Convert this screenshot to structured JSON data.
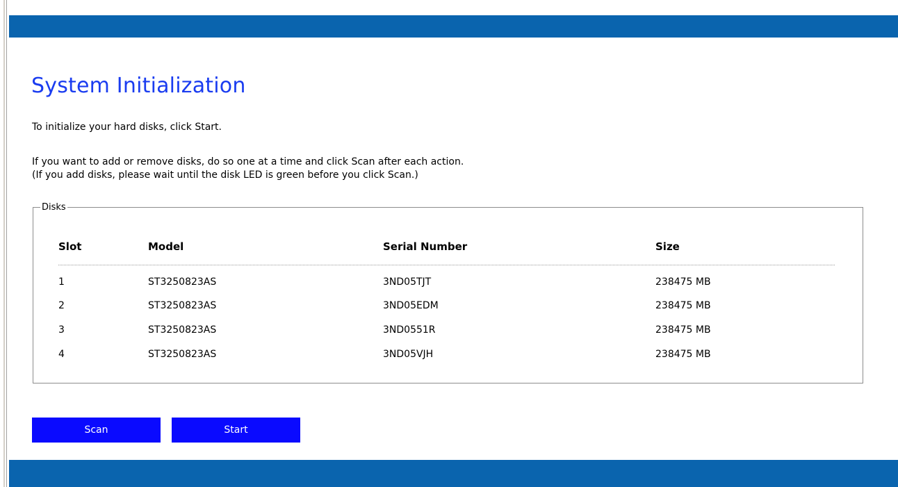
{
  "page": {
    "title": "System Initialization",
    "instruction_start": "To initialize your hard disks, click Start.",
    "instruction_scan_1": "If you want to add or remove disks, do so one at a time and click Scan after each action.",
    "instruction_scan_2": "(If you add disks, please wait until the disk LED is green before you click Scan.)"
  },
  "disks": {
    "legend": "Disks",
    "columns": {
      "slot": "Slot",
      "model": "Model",
      "serial": "Serial Number",
      "size": "Size"
    },
    "rows": [
      {
        "slot": "1",
        "model": "ST3250823AS",
        "serial": "3ND05TJT",
        "size": "238475 MB"
      },
      {
        "slot": "2",
        "model": "ST3250823AS",
        "serial": "3ND05EDM",
        "size": "238475 MB"
      },
      {
        "slot": "3",
        "model": "ST3250823AS",
        "serial": "3ND0551R",
        "size": "238475 MB"
      },
      {
        "slot": "4",
        "model": "ST3250823AS",
        "serial": "3ND05VJH",
        "size": "238475 MB"
      }
    ]
  },
  "buttons": {
    "scan": "Scan",
    "start": "Start"
  },
  "colors": {
    "bar": "#0a64ae",
    "title": "#1a3cf0",
    "button": "#0a0aff"
  }
}
